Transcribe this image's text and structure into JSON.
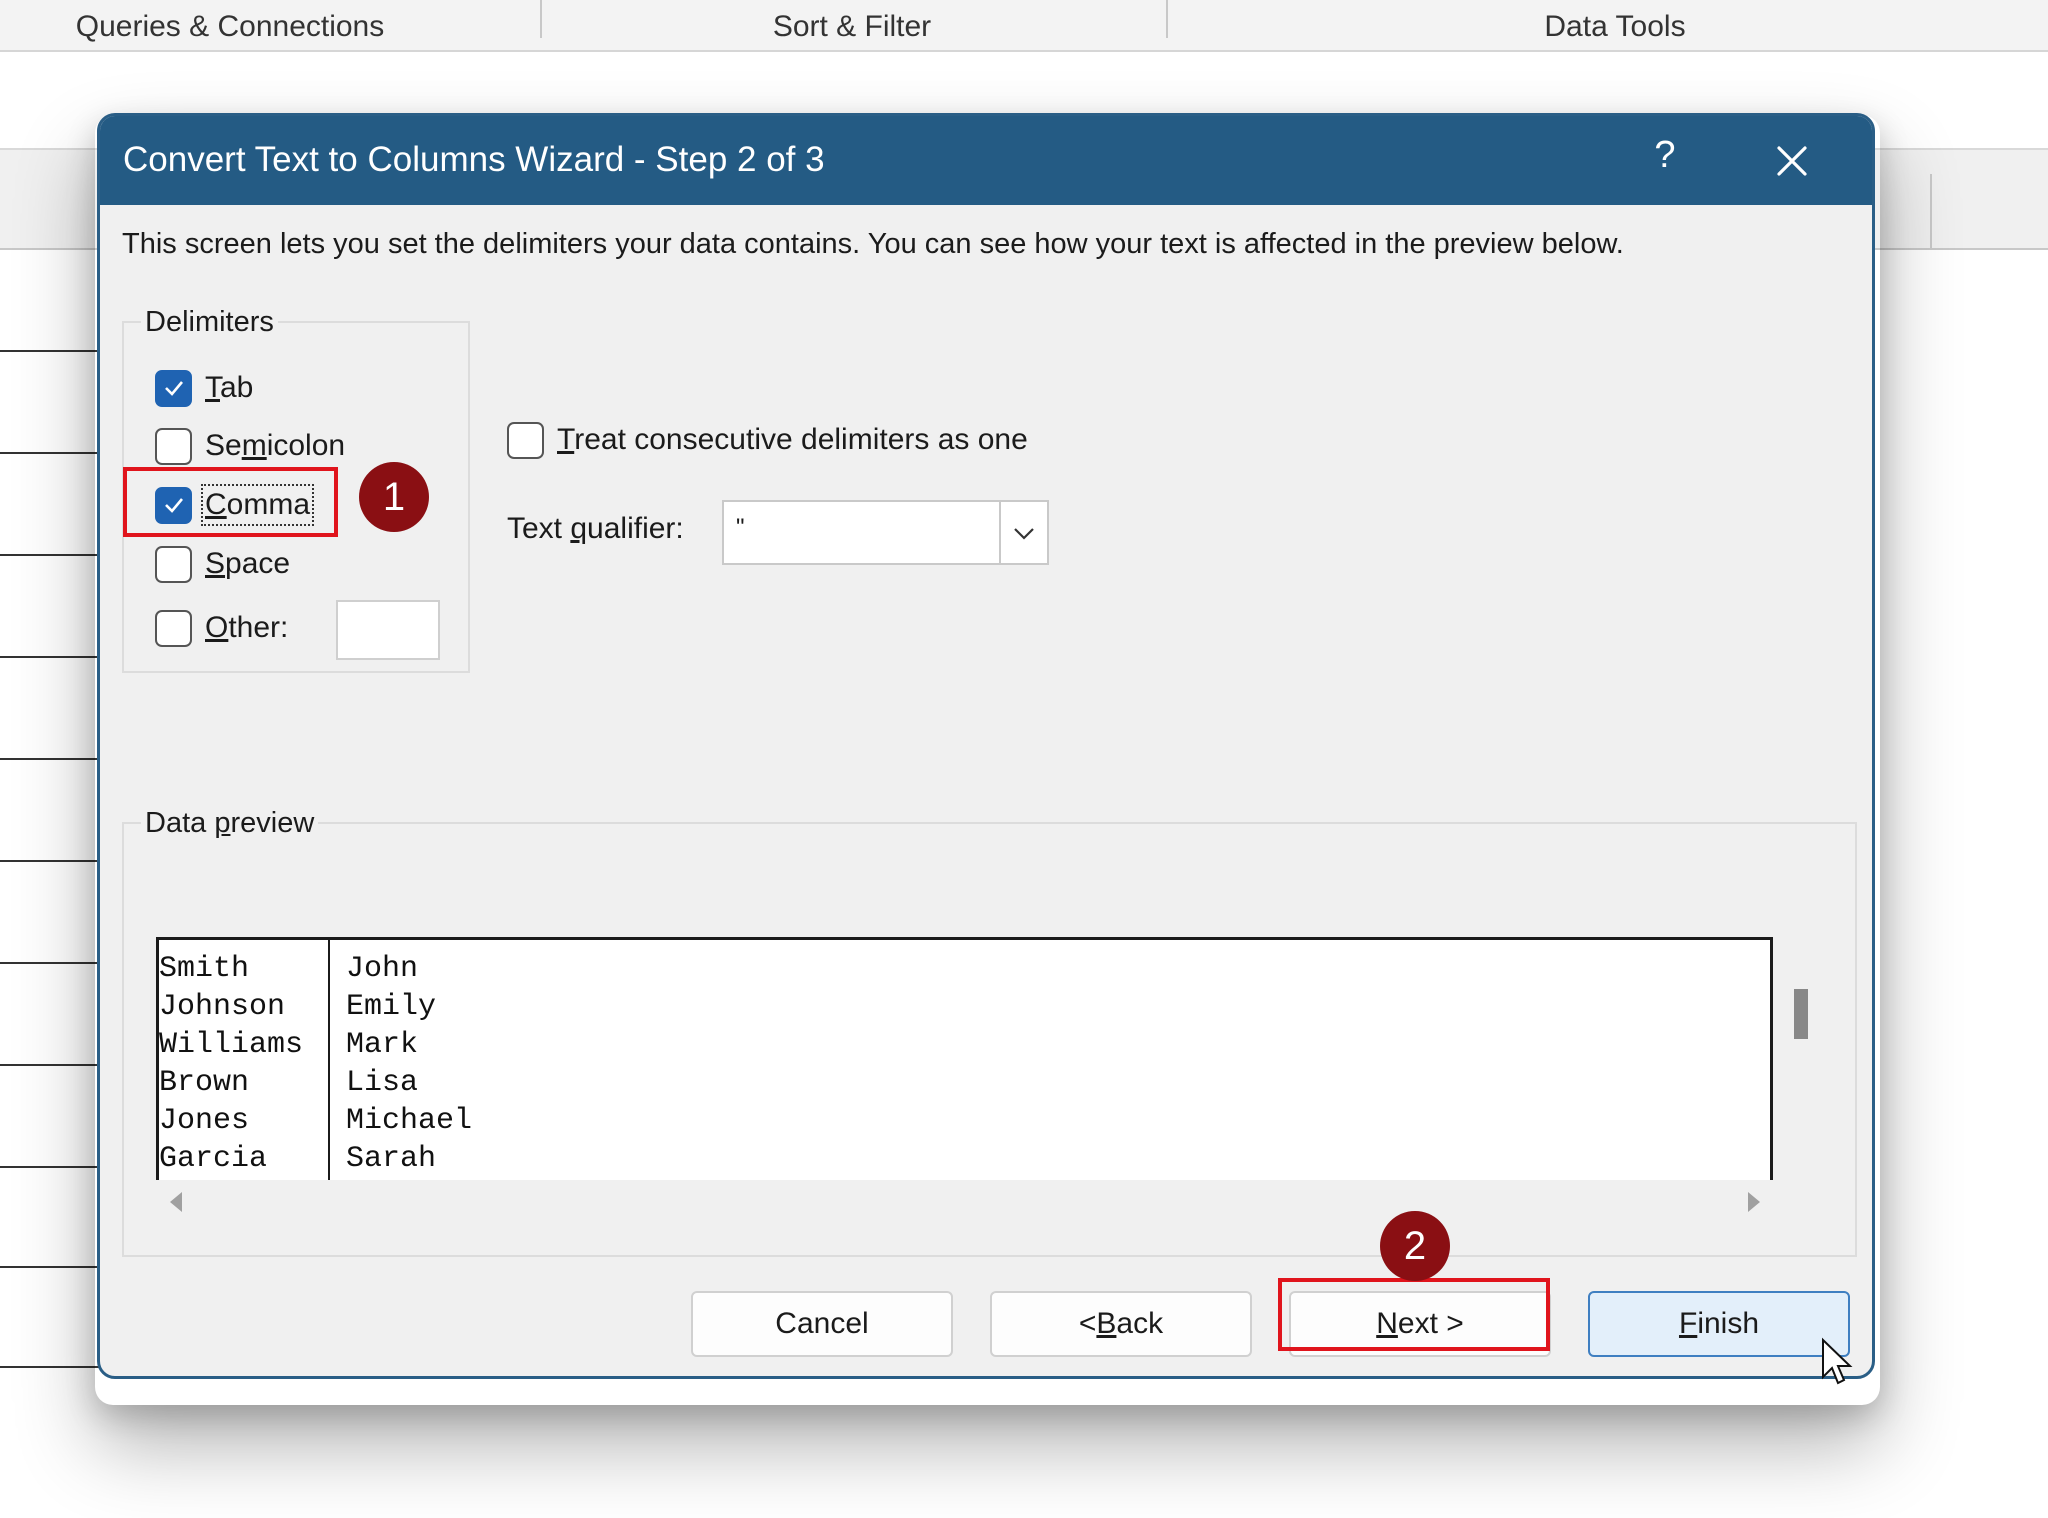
{
  "ribbon": {
    "groups": [
      "Queries & Connections",
      "Sort & Filter",
      "Data Tools"
    ]
  },
  "dialog": {
    "title": "Convert Text to Columns Wizard - Step 2 of 3",
    "help_glyph": "?",
    "intro": "This screen lets you set the delimiters your data contains.  You can see how your text is affected in the preview below.",
    "delimiters": {
      "legend": "Delimiters",
      "tab": {
        "pre": "",
        "key": "T",
        "post": "ab",
        "checked": true
      },
      "semicolon": {
        "pre": "Se",
        "key": "m",
        "post": "icolon",
        "checked": false
      },
      "comma": {
        "pre": "",
        "key": "C",
        "post": "omma",
        "checked": true
      },
      "space": {
        "pre": "",
        "key": "S",
        "post": "pace",
        "checked": false
      },
      "other": {
        "pre": "",
        "key": "O",
        "post": "ther:",
        "checked": false,
        "value": ""
      }
    },
    "consecutive": {
      "pre": "",
      "key": "T",
      "post": "reat consecutive delimiters as one",
      "checked": false
    },
    "qualifier": {
      "label_pre": "Text ",
      "label_key": "q",
      "label_post": "ualifier:",
      "value": "\""
    },
    "preview": {
      "legend_pre": "Data ",
      "legend_key": "p",
      "legend_post": "review",
      "last_names": [
        "Smith",
        "Johnson",
        "Williams",
        "Brown",
        "Jones",
        "Garcia"
      ],
      "first_names": [
        "John",
        "Emily",
        "Mark",
        "Lisa",
        "Michael",
        "Sarah"
      ]
    },
    "buttons": {
      "cancel": "Cancel",
      "back_pre": "< ",
      "back_key": "B",
      "back_post": "ack",
      "next_key": "N",
      "next_post": "ext >",
      "finish_key": "F",
      "finish_post": "inish"
    }
  },
  "annotations": {
    "step1": "1",
    "step2": "2"
  },
  "colors": {
    "title_bar": "#245b84",
    "checkbox_checked": "#1f63b2",
    "highlight_box": "#e0141c",
    "step_badge": "#8a0f13"
  },
  "icons": [
    "close-icon",
    "check-icon",
    "chevron-down-icon",
    "scroll-left-icon",
    "scroll-right-icon",
    "mouse-cursor-icon"
  ]
}
